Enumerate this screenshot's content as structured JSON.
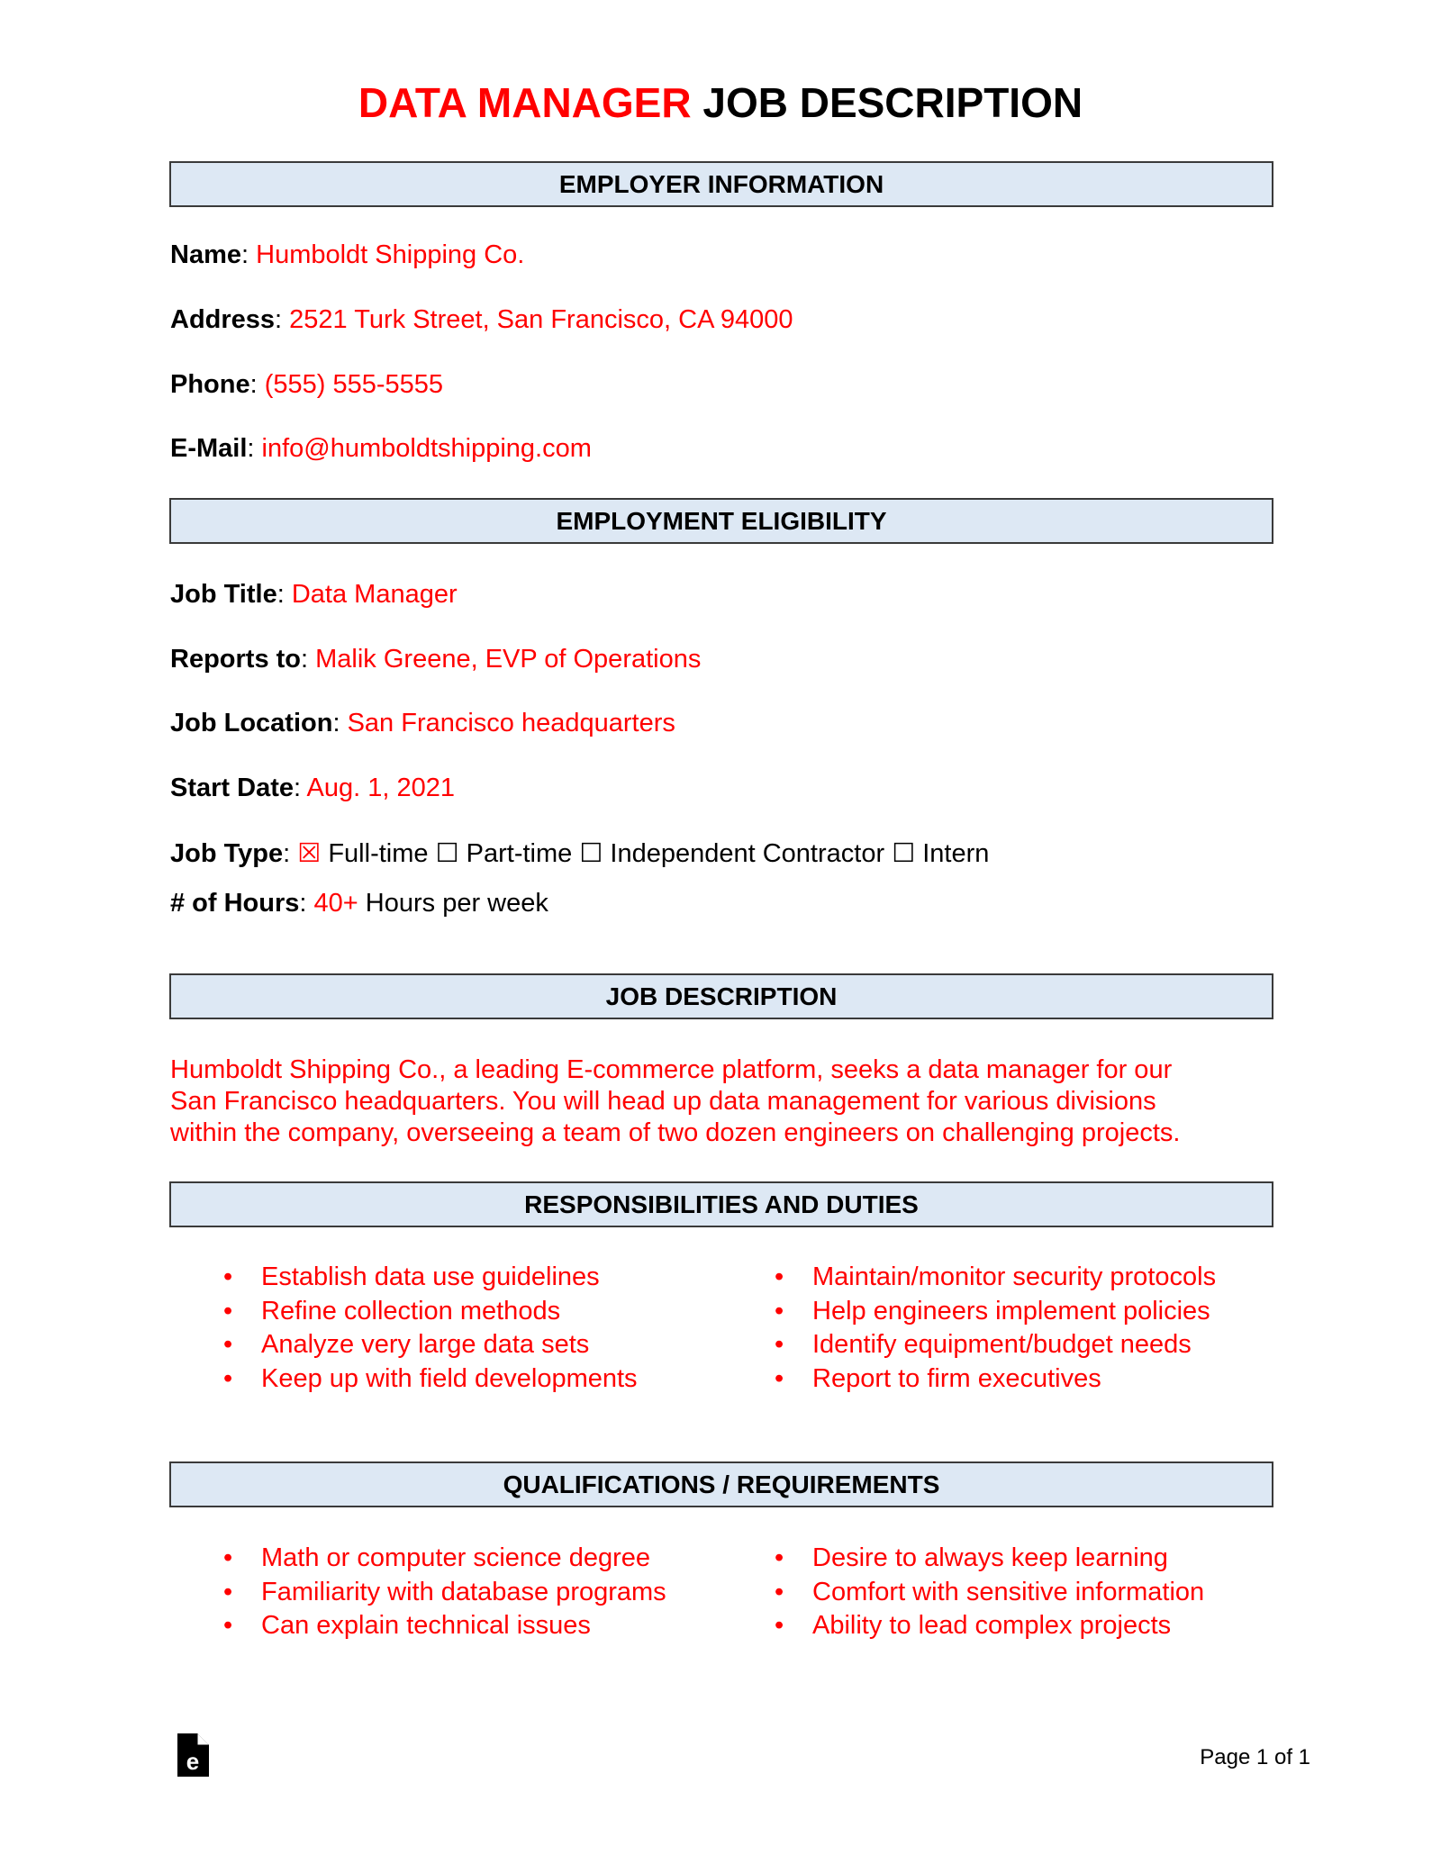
{
  "title": {
    "highlight": "DATA MANAGER",
    "rest": "JOB DESCRIPTION"
  },
  "sections": {
    "employer": "EMPLOYER INFORMATION",
    "eligibility": "EMPLOYMENT ELIGIBILITY",
    "description": "JOB DESCRIPTION",
    "responsibilities": "RESPONSIBILITIES AND DUTIES",
    "qualifications": "QUALIFICATIONS / REQUIREMENTS"
  },
  "employer": {
    "name": {
      "label": "Name",
      "value": "Humboldt Shipping Co."
    },
    "address": {
      "label": "Address",
      "value": "2521 Turk Street, San Francisco, CA 94000"
    },
    "phone": {
      "label": "Phone",
      "value": "(555) 555-5555"
    },
    "email": {
      "label": "E-Mail",
      "value": "info@humboldtshipping.com"
    }
  },
  "eligibility": {
    "job_title": {
      "label": "Job Title",
      "value": "Data Manager"
    },
    "reports_to": {
      "label": "Reports to",
      "value": "Malik Greene, EVP of Operations"
    },
    "location": {
      "label": "Job Location",
      "value": "San Francisco headquarters"
    },
    "start_date": {
      "label": "Start Date",
      "value": "Aug. 1, 2021"
    },
    "job_type": {
      "label": "Job Type",
      "options": [
        {
          "label": "Full-time",
          "checked": true,
          "glyph": "☒"
        },
        {
          "label": "Part-time",
          "checked": false,
          "glyph": "☐"
        },
        {
          "label": "Independent Contractor",
          "checked": false,
          "glyph": "☐"
        },
        {
          "label": "Intern",
          "checked": false,
          "glyph": "☐"
        }
      ]
    },
    "hours": {
      "label": "# of Hours",
      "value": "40+",
      "suffix": "Hours per week"
    }
  },
  "description": "Humboldt Shipping Co., a leading E-commerce platform, seeks a data manager for our San Francisco headquarters. You will head up data management for various divisions within the company, overseeing a team of two dozen engineers on challenging projects.",
  "description_lines": [
    "Humboldt Shipping Co., a leading E-commerce platform, seeks a data manager for our",
    "San Francisco headquarters. You will head up data management for various divisions",
    "within the company, overseeing a team of two dozen engineers on challenging projects."
  ],
  "responsibilities": {
    "left": [
      "Establish data use guidelines",
      "Refine collection methods",
      "Analyze very large data sets",
      "Keep up with field developments"
    ],
    "right": [
      "Maintain/monitor security protocols",
      "Help engineers implement policies",
      "Identify equipment/budget needs",
      "Report to firm executives"
    ]
  },
  "qualifications": {
    "left": [
      "Math or computer science degree",
      "Familiarity with database programs",
      "Can explain technical issues"
    ],
    "right": [
      "Desire to always keep learning",
      "Comfort with sensitive information",
      "Ability to lead complex projects"
    ]
  },
  "bullet": "•",
  "footer": {
    "logo_icon": "eforms-logo-icon",
    "page": "Page 1 of 1"
  },
  "colors": {
    "accent": "#ff0000",
    "header_fill": "#dde8f4",
    "header_border": "#3a3a3a"
  }
}
